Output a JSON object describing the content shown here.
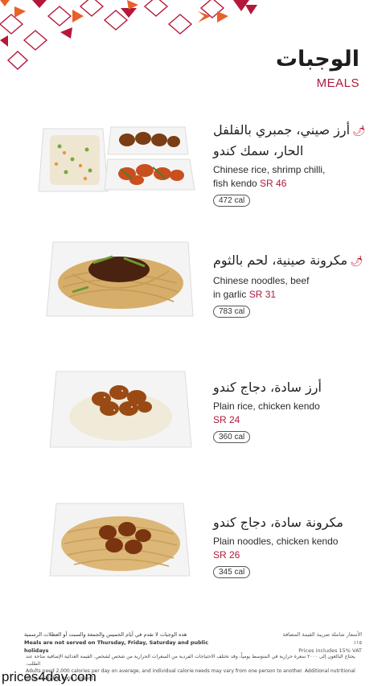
{
  "header": {
    "title_ar": "الوجبات",
    "title_en": "MEALS"
  },
  "items": [
    {
      "name_ar_lines": [
        "أرز صيني، جمبري بالفلفل",
        "الحار، سمك كندو"
      ],
      "spicy": true,
      "name_en_lines": [
        "Chinese rice, shrimp chilli,",
        "fish kendo"
      ],
      "price": "SR 46",
      "calories": "472 cal"
    },
    {
      "name_ar_lines": [
        "مكرونة صينية، لحم بالثوم"
      ],
      "spicy": true,
      "name_en_lines": [
        "Chinese noodles, beef",
        "in garlic"
      ],
      "price": "SR 31",
      "calories": "783 cal"
    },
    {
      "name_ar_lines": [
        "أرز سادة، دجاج كندو"
      ],
      "spicy": false,
      "name_en_lines": [
        "Plain rice, chicken kendo"
      ],
      "price": "SR 24",
      "calories": "360 cal"
    },
    {
      "name_ar_lines": [
        "مكرونة سادة، دجاج كندو"
      ],
      "spicy": false,
      "name_en_lines": [
        "Plain noodles, chicken kendo"
      ],
      "price": "SR 26",
      "calories": "345 cal"
    }
  ],
  "footer": {
    "meals_note_ar": "هذه الوجبات لا تقدم في أيام الخميس والجمعة والسبت أو العطلات الرسمية",
    "meals_note_en": "Meals are not served on Thursday, Friday, Saturday and public holidays",
    "vat_ar": "الأسعار شاملة ضريبة القيمة المضافة ١٥٪",
    "vat_en": "Prices includes 15% VAT",
    "calories_ar": "يحتاج البالغون إلى ٢٠٠٠ سعرة حرارية في المتوسط يومياً، وقد تختلف الاحتياجات الفردية من السعرات الحرارية من شخص لشخص. القيمة الغذائية الإضافية متاحة عند الطلب.",
    "calories_en": "Adults need 2,000 calories per day on average, and individual calorie needs may vary from one person to another. Additional nutritional data available upon request."
  },
  "watermark": "prices4day.com",
  "colors": {
    "accent": "#b0193b",
    "pattern_red": "#b5173a",
    "pattern_orange": "#e8602a"
  },
  "icons": {
    "spicy": "chili-icon"
  }
}
